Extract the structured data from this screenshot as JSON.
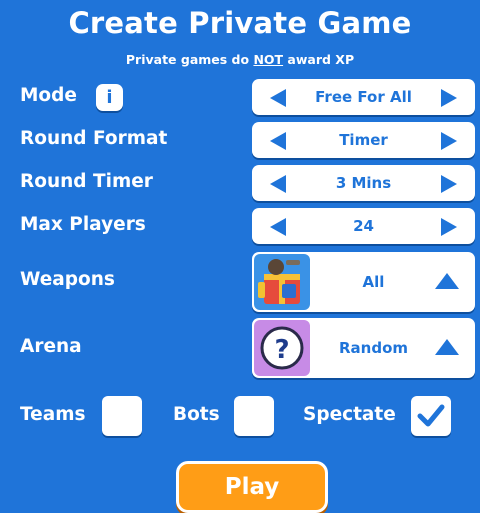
{
  "header": {
    "title": "Create Private Game",
    "subtitle_pre": "Private games do ",
    "subtitle_em": "NOT",
    "subtitle_post": " award XP"
  },
  "settings": {
    "mode": {
      "label": "Mode",
      "info_icon_text": "i",
      "value": "Free For All"
    },
    "round_format": {
      "label": "Round Format",
      "value": "Timer"
    },
    "round_timer": {
      "label": "Round Timer",
      "value": "3 Mins"
    },
    "max_players": {
      "label": "Max Players",
      "value": "24"
    },
    "weapons": {
      "label": "Weapons",
      "value": "All",
      "icon": "weapons-crate-icon"
    },
    "arena": {
      "label": "Arena",
      "value": "Random",
      "icon": "question-mark-icon"
    }
  },
  "toggles": {
    "teams": {
      "label": "Teams",
      "checked": false
    },
    "bots": {
      "label": "Bots",
      "checked": false
    },
    "spectate": {
      "label": "Spectate",
      "checked": true
    }
  },
  "play_button": {
    "label": "Play"
  },
  "colors": {
    "background": "#1f74d9",
    "accent": "#1f74d9",
    "play": "#ff9d16",
    "panel": "#ffffff"
  }
}
